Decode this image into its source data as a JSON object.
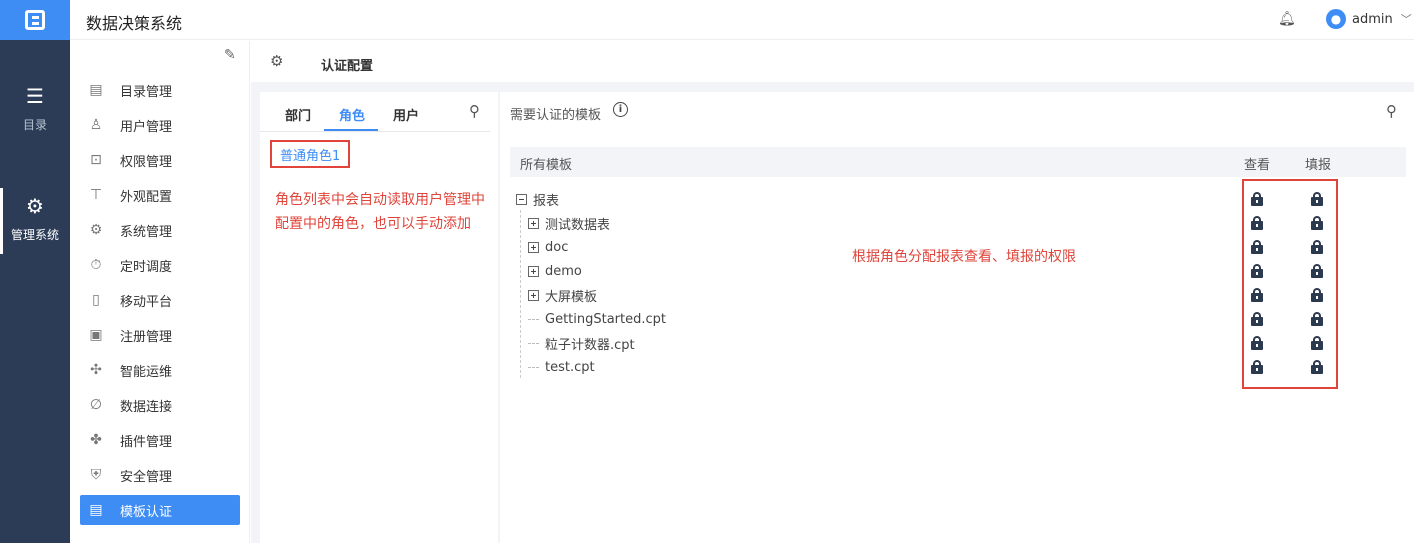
{
  "rail": {
    "items": [
      {
        "label": "目录",
        "icon": "list-icon"
      },
      {
        "label": "管理系统",
        "icon": "gear-icon"
      }
    ]
  },
  "topbar": {
    "title": "数据决策系统",
    "username": "admin"
  },
  "menu": {
    "items": [
      {
        "label": "目录管理",
        "icon": "catalog-icon"
      },
      {
        "label": "用户管理",
        "icon": "user-icon"
      },
      {
        "label": "权限管理",
        "icon": "lock-icon"
      },
      {
        "label": "外观配置",
        "icon": "brush-icon"
      },
      {
        "label": "系统管理",
        "icon": "gear-icon"
      },
      {
        "label": "定时调度",
        "icon": "timer-icon"
      },
      {
        "label": "移动平台",
        "icon": "mobile-icon"
      },
      {
        "label": "注册管理",
        "icon": "register-icon"
      },
      {
        "label": "智能运维",
        "icon": "network-icon"
      },
      {
        "label": "数据连接",
        "icon": "link-icon"
      },
      {
        "label": "插件管理",
        "icon": "plugin-icon"
      },
      {
        "label": "安全管理",
        "icon": "shield-icon"
      },
      {
        "label": "模板认证",
        "icon": "template-icon",
        "active": true
      }
    ]
  },
  "content": {
    "title": "认证配置"
  },
  "role_panel": {
    "tabs": [
      "部门",
      "角色",
      "用户"
    ],
    "active_tab": "角色",
    "roles": [
      "普通角色1"
    ],
    "note_line1": "角色列表中会自动读取用户管理中",
    "note_line2": "配置中的角色，也可以手动添加"
  },
  "template_panel": {
    "header": "需要认证的模板",
    "columns": {
      "all": "所有模板",
      "view": "查看",
      "fill": "填报"
    },
    "tree": {
      "root": "报表",
      "folders": [
        "测试数据表",
        "doc",
        "demo",
        "大屏模板"
      ],
      "files": [
        "GettingStarted.cpt",
        "粒子计数器.cpt",
        "test.cpt"
      ]
    },
    "note": "根据角色分配报表查看、填报的权限"
  },
  "colors": {
    "accent": "#3e8df5",
    "rail_bg": "#2c3c56",
    "annotation": "#e0443a"
  }
}
